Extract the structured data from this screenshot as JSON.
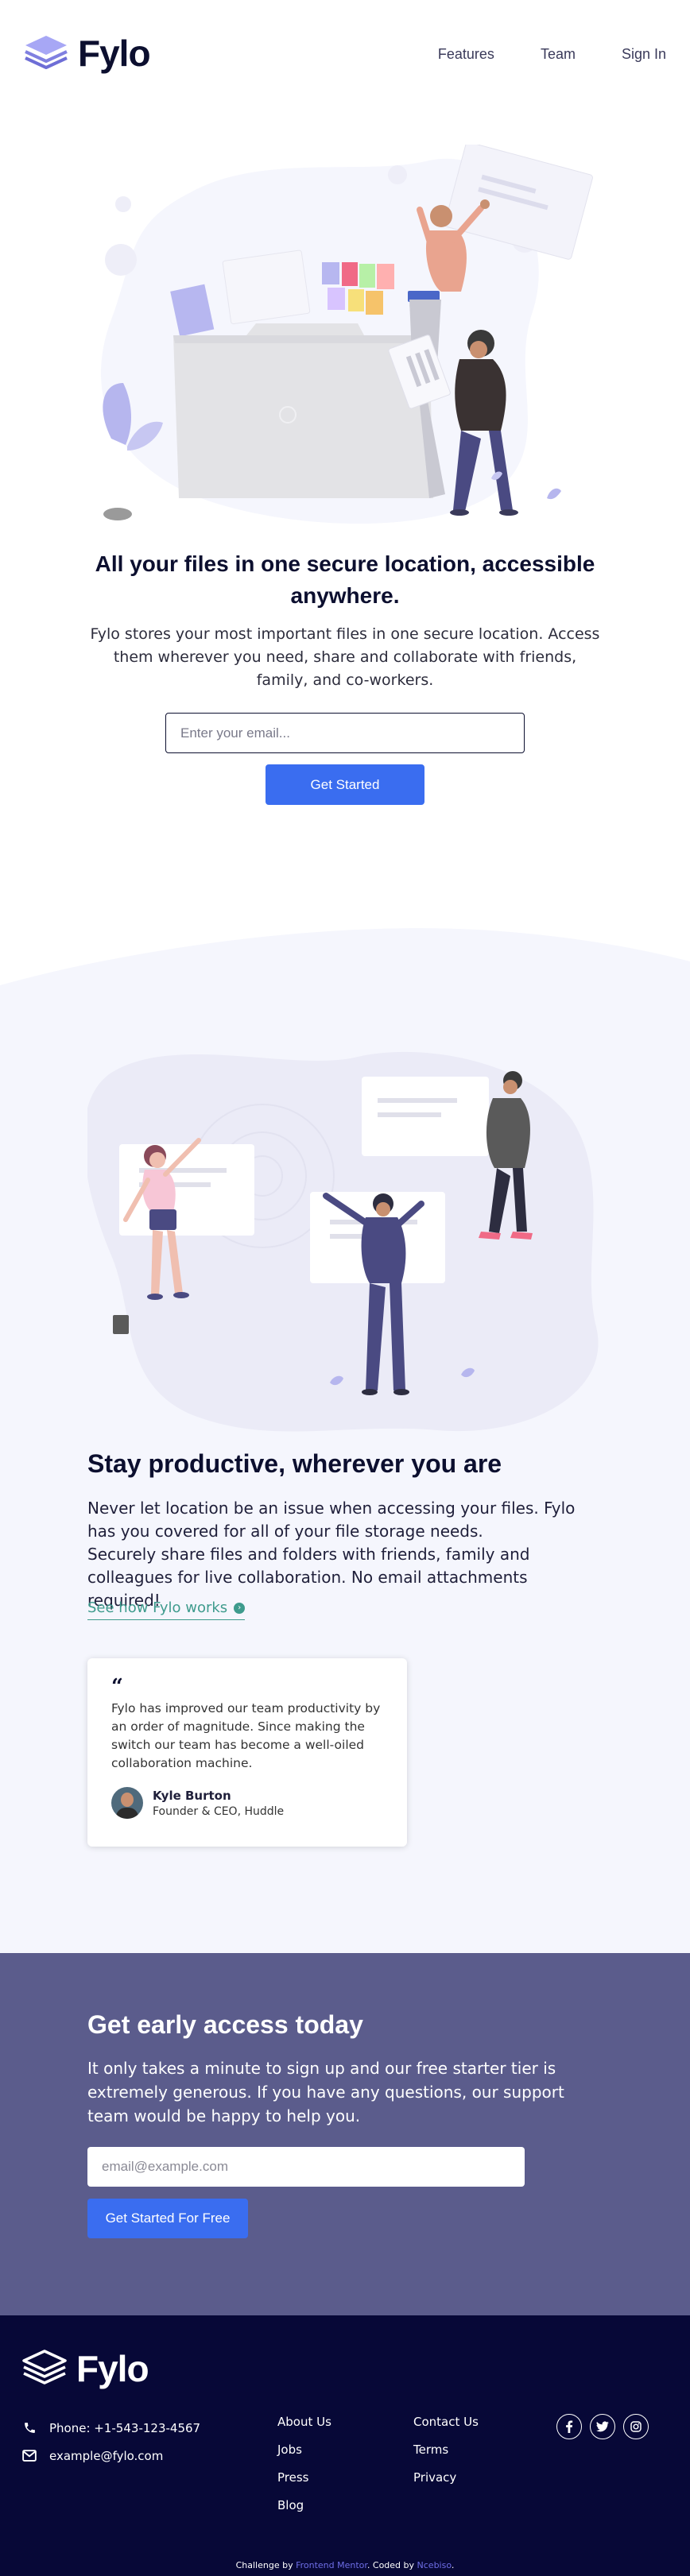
{
  "header": {
    "brand": "Fylo",
    "nav": [
      "Features",
      "Team",
      "Sign In"
    ]
  },
  "hero": {
    "title": "All your files in one secure location, accessible anywhere.",
    "text": "Fylo stores your most important files in one secure location. Access them wherever you need, share and collaborate with friends, family, and co-workers.",
    "input_placeholder": "Enter your email...",
    "button": "Get Started"
  },
  "productive": {
    "title": "Stay productive, wherever you are",
    "paragraphs": [
      "Never let location be an issue when accessing your files. Fylo has you covered for all of your file storage needs.",
      "Securely share files and folders with friends, family and colleagues for live collaboration. No email attachments required!"
    ],
    "link": "See how Fylo works"
  },
  "testimonial": {
    "quote_mark": "“",
    "text": "Fylo has improved our team productivity by an order of magnitude. Since making the switch our team has become a well-oiled collaboration machine.",
    "name": "Kyle Burton",
    "role": "Founder & CEO, Huddle"
  },
  "early_access": {
    "title": "Get early access today",
    "text": "It only takes a minute to sign up and our free starter tier is extremely generous. If you have any questions, our support team would be happy to help you.",
    "input_placeholder": "email@example.com",
    "button": "Get Started For Free"
  },
  "footer": {
    "brand": "Fylo",
    "phone": "Phone: +1-543-123-4567",
    "email": "example@fylo.com",
    "links_col1": [
      "About Us",
      "Jobs",
      "Press",
      "Blog"
    ],
    "links_col2": [
      "Contact Us",
      "Terms",
      "Privacy"
    ],
    "socials": [
      "facebook-icon",
      "twitter-icon",
      "instagram-icon"
    ],
    "attribution": {
      "prefix": "Challenge by ",
      "challenge_link": "Frontend Mentor",
      "middle": ". Coded by ",
      "author_link": "Ncebiso",
      "suffix": "."
    }
  },
  "colors": {
    "navy": "#0c0f2f",
    "blue": "#3a6df0",
    "teal": "#3e9b8d",
    "section_bg": "#f5f6fd",
    "early_bg": "#5b5c8c",
    "footer_bg": "#070837"
  }
}
